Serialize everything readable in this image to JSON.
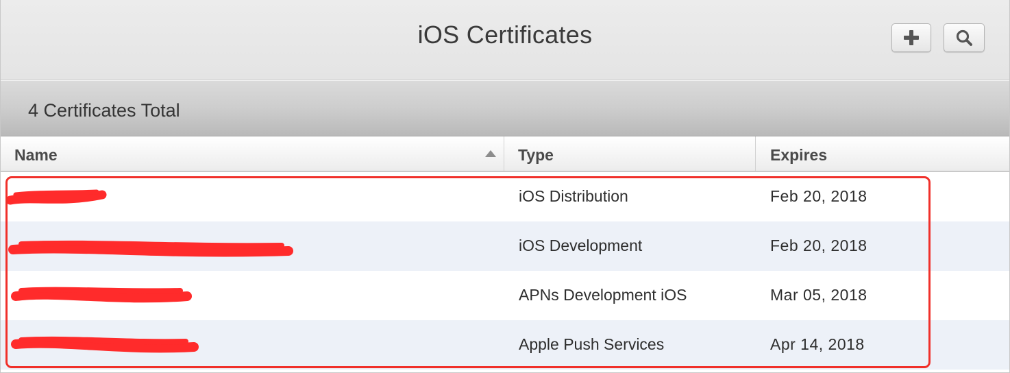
{
  "header": {
    "title": "iOS Certificates",
    "add_icon": "plus-icon",
    "search_icon": "search-icon"
  },
  "summary": {
    "text": "4 Certificates Total"
  },
  "table": {
    "columns": [
      "Name",
      "Type",
      "Expires"
    ],
    "sort_column": "Name",
    "sort_direction": "ascending",
    "rows": [
      {
        "name": "",
        "type": "iOS Distribution",
        "expires": "Feb 20, 2018"
      },
      {
        "name": "",
        "type": "iOS Development",
        "expires": "Feb 20, 2018"
      },
      {
        "name": "",
        "type": "APNs Development iOS",
        "expires": "Mar 05, 2018"
      },
      {
        "name": "",
        "type": "Apple Push Services",
        "expires": "Apr 14, 2018"
      }
    ]
  },
  "colors": {
    "highlight": "#f0302a",
    "alt_row": "#edf1f8"
  }
}
